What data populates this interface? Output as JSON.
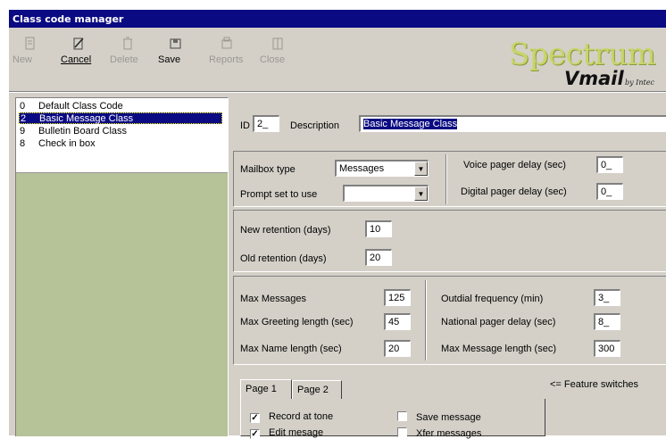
{
  "window": {
    "title": "Class code manager"
  },
  "toolbar": {
    "buttons": [
      {
        "label": "New",
        "icon": "new-icon",
        "enabled": false
      },
      {
        "label": "Cancel",
        "icon": "cancel-icon",
        "enabled": true
      },
      {
        "label": "Delete",
        "icon": "delete-icon",
        "enabled": false
      },
      {
        "label": "Save",
        "icon": "save-icon",
        "enabled": true
      },
      {
        "label": "Reports",
        "icon": "reports-icon",
        "enabled": false
      },
      {
        "label": "Close",
        "icon": "close-icon",
        "enabled": false
      }
    ]
  },
  "logo": {
    "brand": "Spectrum",
    "product": "Vmail",
    "byline": "by Intec"
  },
  "class_list": {
    "items": [
      {
        "code": "0",
        "name": "Default Class Code",
        "selected": false
      },
      {
        "code": "2",
        "name": "Basic Message Class",
        "selected": true
      },
      {
        "code": "9",
        "name": "Bulletin Board Class",
        "selected": false
      },
      {
        "code": "8",
        "name": "Check in box",
        "selected": false
      }
    ]
  },
  "details": {
    "id_label": "ID",
    "id_value": "2_",
    "description_label": "Description",
    "description_value": "Basic Message Class"
  },
  "mailbox": {
    "type_label": "Mailbox type",
    "type_value": "Messages",
    "prompt_label": "Prompt set to use",
    "prompt_value": "",
    "voice_pager_label": "Voice pager delay (sec)",
    "voice_pager_value": "0_",
    "digital_pager_label": "Digital pager delay (sec)",
    "digital_pager_value": "0_"
  },
  "retention": {
    "new_label": "New retention (days)",
    "new_value": "10",
    "old_label": "Old retention (days)",
    "old_value": "20"
  },
  "limits": {
    "max_messages_label": "Max Messages",
    "max_messages_value": "125",
    "max_greeting_label": "Max Greeting length (sec)",
    "max_greeting_value": "45",
    "max_name_label": "Max Name length (sec)",
    "max_name_value": "20",
    "outdial_label": "Outdial frequency (min)",
    "outdial_value": "3_",
    "national_pager_label": "National pager delay (sec)",
    "national_pager_value": "8_",
    "max_message_length_label": "Max Message length (sec)",
    "max_message_length_value": "300"
  },
  "tabs": [
    {
      "label": "Page 1",
      "active": true
    },
    {
      "label": "Page 2",
      "active": false
    }
  ],
  "feature_switches_hint": "<= Feature switches",
  "features": [
    {
      "label": "Record at tone",
      "checked": true
    },
    {
      "label": "Save message",
      "checked": false
    },
    {
      "label": "Edit mesage",
      "checked": true
    },
    {
      "label": "Xfer messages",
      "checked": false
    }
  ]
}
